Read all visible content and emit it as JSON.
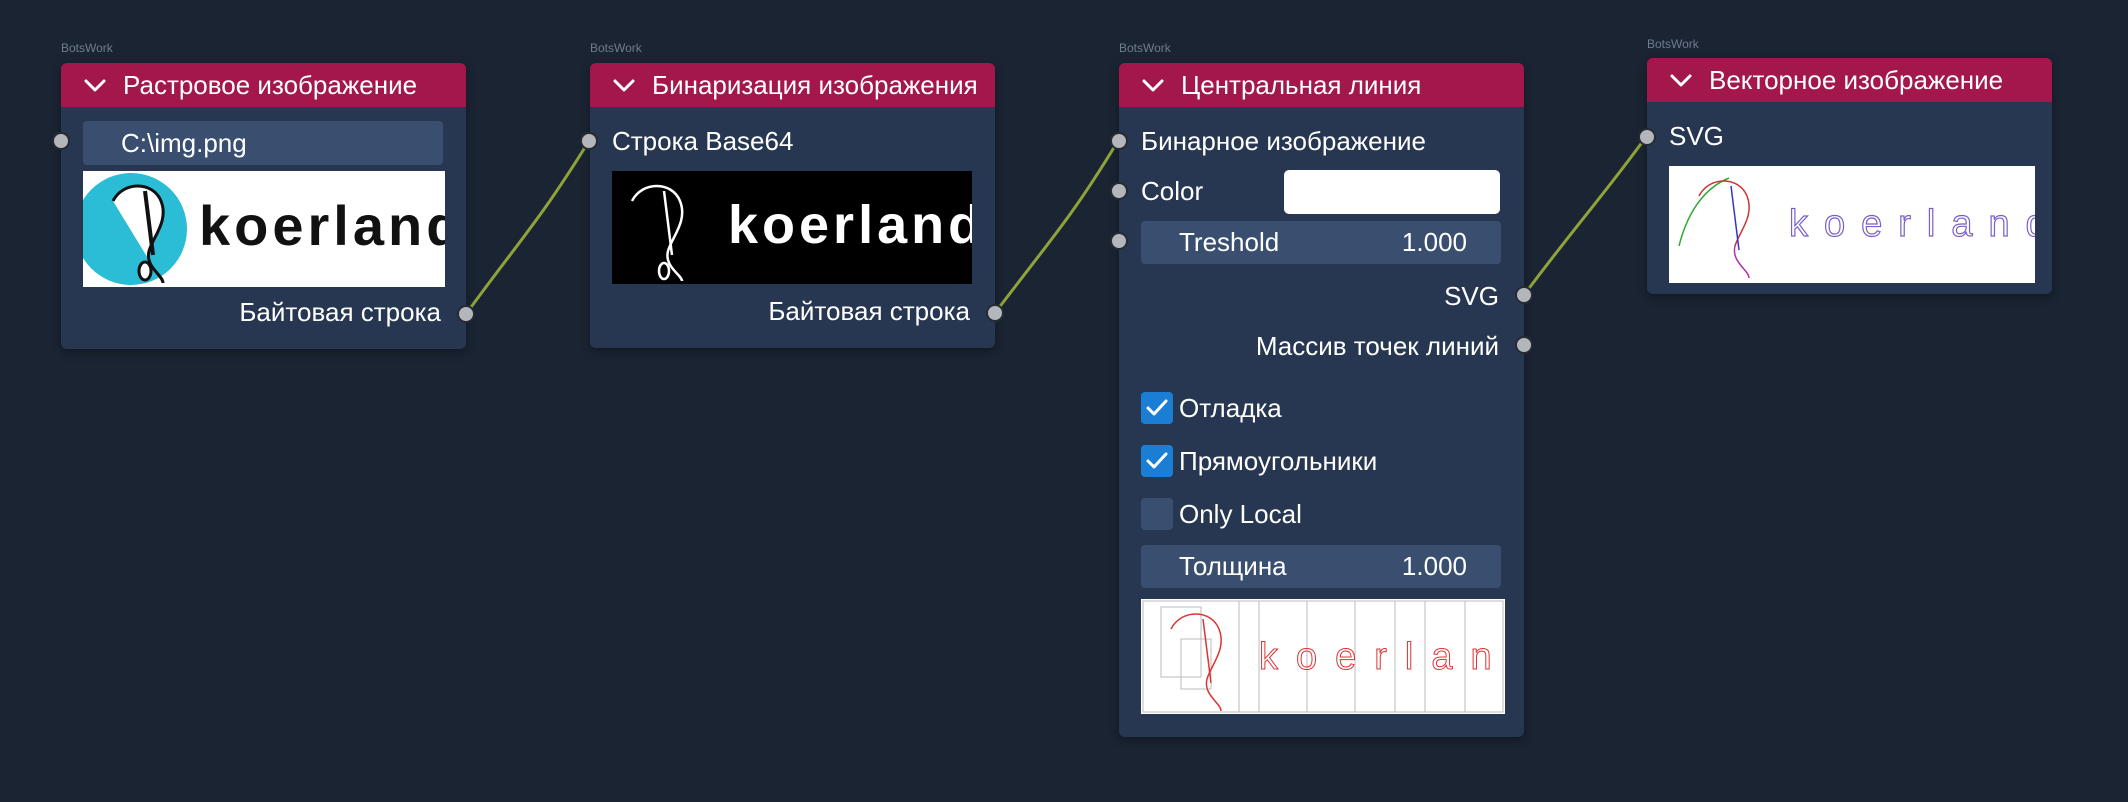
{
  "brand_tag": "BotsWork",
  "nodes": {
    "raster": {
      "title": "Растровое изображение",
      "path_value": "C:\\img.png",
      "image_text": "koerland",
      "output_label": "Байтовая строка"
    },
    "binarize": {
      "title": "Бинаризация изображения",
      "input_label": "Строка Base64",
      "image_text": "koerland",
      "output_label": "Байтовая строка"
    },
    "centerline": {
      "title": "Центральная линия",
      "input_binary_label": "Бинарное изображение",
      "color_label": "Color",
      "color_value": "#ffffff",
      "treshold_label": "Treshold",
      "treshold_value": "1.000",
      "output_svg_label": "SVG",
      "output_points_label": "Массив точек линий",
      "debug_label": "Отладка",
      "debug_checked": true,
      "rects_label": "Прямоугольники",
      "rects_checked": true,
      "only_local_label": "Only Local",
      "only_local_checked": false,
      "thickness_label": "Толщина",
      "thickness_value": "1.000",
      "image_text": "koerland"
    },
    "vector": {
      "title": "Векторное изображение",
      "input_label": "SVG",
      "image_text": "koerland"
    }
  },
  "colors": {
    "background": "#1b2433",
    "node_body": "#273751",
    "node_header": "#a3174c",
    "field": "#3a4f70",
    "wire": "#8fa33a",
    "checkbox_on": "#1a7fd4",
    "socket": "#b3b6ba"
  },
  "icons": {
    "collapse": "chevron-down-icon",
    "check": "check-icon"
  }
}
